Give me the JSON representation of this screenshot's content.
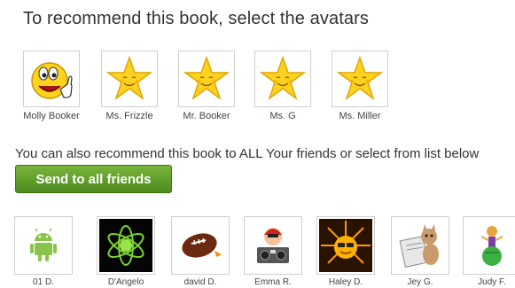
{
  "title": "To recommend this book, select the avatars",
  "avatars": [
    {
      "name": "Molly Booker",
      "icon": "smiley-thumbs-up-icon"
    },
    {
      "name": "Ms. Frizzle",
      "icon": "star-icon"
    },
    {
      "name": "Mr. Booker",
      "icon": "star-icon"
    },
    {
      "name": "Ms. G",
      "icon": "star-icon"
    },
    {
      "name": "Ms. Miller",
      "icon": "star-icon"
    }
  ],
  "info_text": "You can also recommend this book to ALL Your friends or select from list below",
  "send_button": "Send to all friends",
  "friends": [
    {
      "name": "01 D.",
      "icon": "android-icon"
    },
    {
      "name": "D'Angelo",
      "icon": "atom-icon"
    },
    {
      "name": "david D.",
      "icon": "football-icon"
    },
    {
      "name": "Emma R.",
      "icon": "boombox-icon"
    },
    {
      "name": "Haley D.",
      "icon": "sun-glasses-icon"
    },
    {
      "name": "Jey G.",
      "icon": "cat-reading-icon"
    },
    {
      "name": "Judy F.",
      "icon": "bug-ball-icon"
    }
  ]
}
